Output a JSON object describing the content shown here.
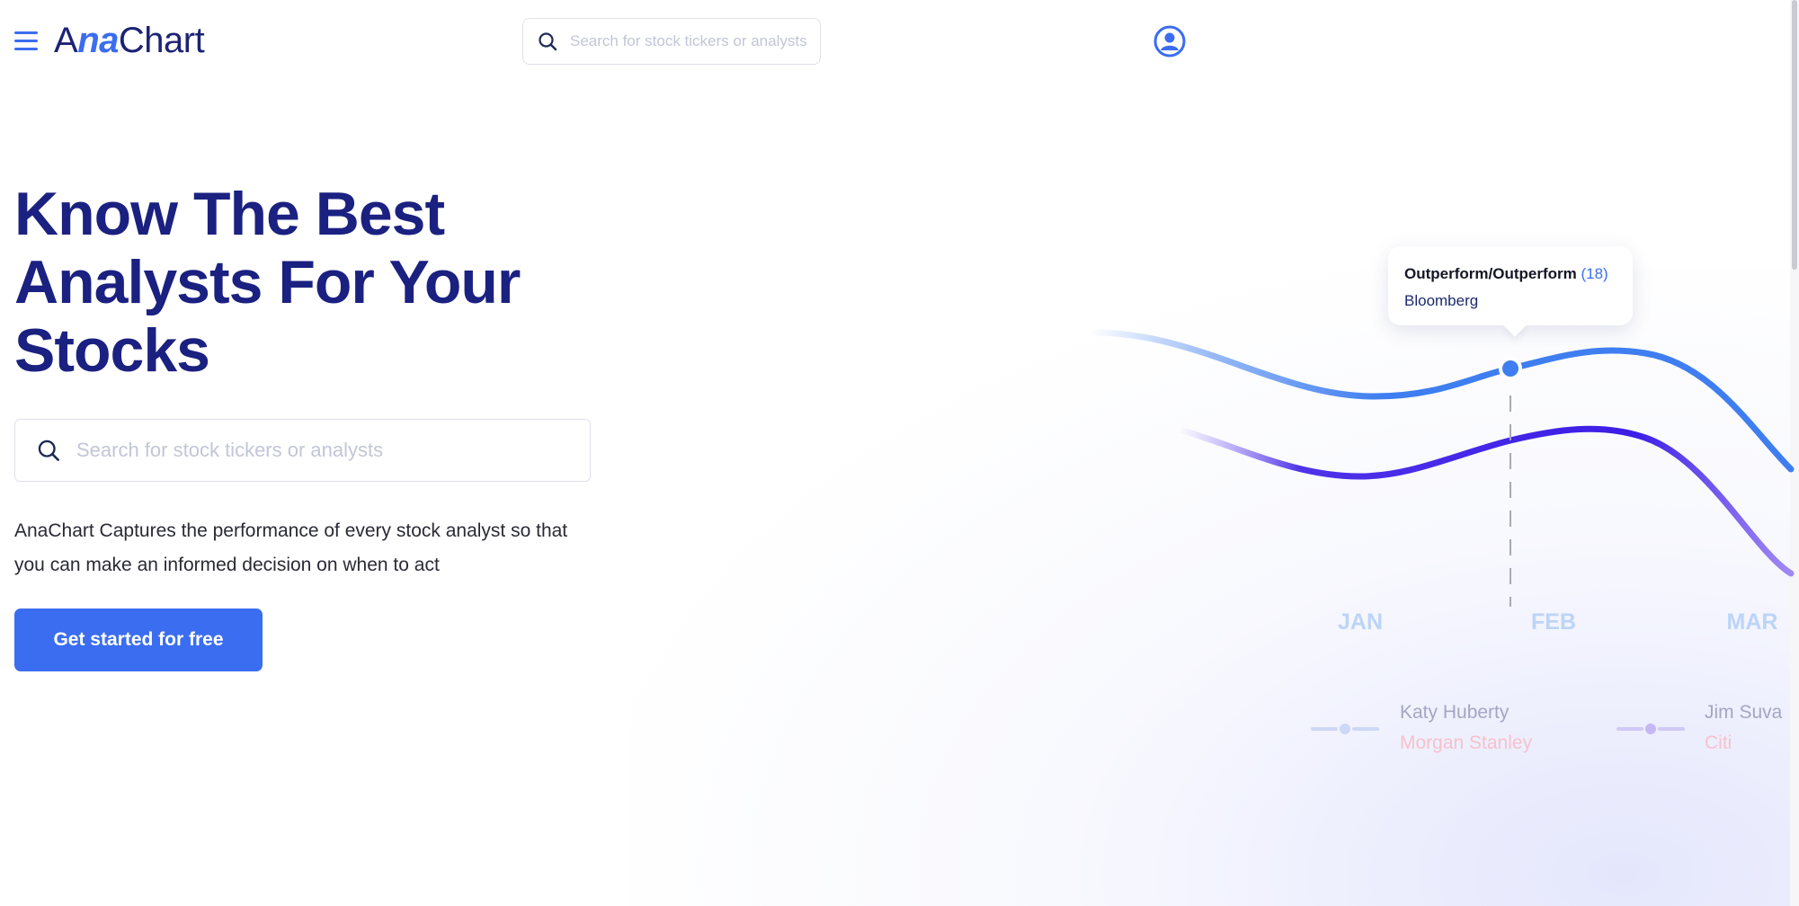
{
  "header": {
    "logo_text_start": "A",
    "logo_text_accent": "na",
    "logo_text_end": "Chart",
    "search_placeholder": "Search for stock tickers or analysts",
    "menu_icon": "hamburger-menu-icon",
    "account_icon": "user-avatar-icon"
  },
  "hero": {
    "title_line1": "Know The Best",
    "title_line2": "Analysts For Your",
    "title_line3": "Stocks",
    "search_placeholder": "Search for stock tickers or analysts",
    "description_line1": "AnaChart Captures the performance of every stock analyst so that",
    "description_line2": "you can make an informed decision on when to act",
    "cta_label": "Get started for free"
  },
  "tooltip": {
    "rating": "Outperform/Outperform",
    "count": "(18)",
    "source": "Bloomberg"
  },
  "colors": {
    "primary": "#3b6df0",
    "heading": "#1b2180",
    "series_1": "#3f7ef0",
    "series_2": "#3b1de6",
    "month_label": "#bcd4f6",
    "legend_firm": "#f6c1cb"
  },
  "chart_data": {
    "type": "line",
    "x": [
      "JAN",
      "FEB",
      "MAR"
    ],
    "series": [
      {
        "name": "Katy Huberty",
        "firm": "Morgan Stanley",
        "color": "#3f7ef0"
      },
      {
        "name": "Jim Suva",
        "firm": "Citi",
        "color": "#3b1de6"
      }
    ],
    "highlight": {
      "x": "FEB",
      "label": "Outperform/Outperform (18)",
      "source": "Bloomberg"
    },
    "grid": false,
    "legend": "bottom"
  }
}
